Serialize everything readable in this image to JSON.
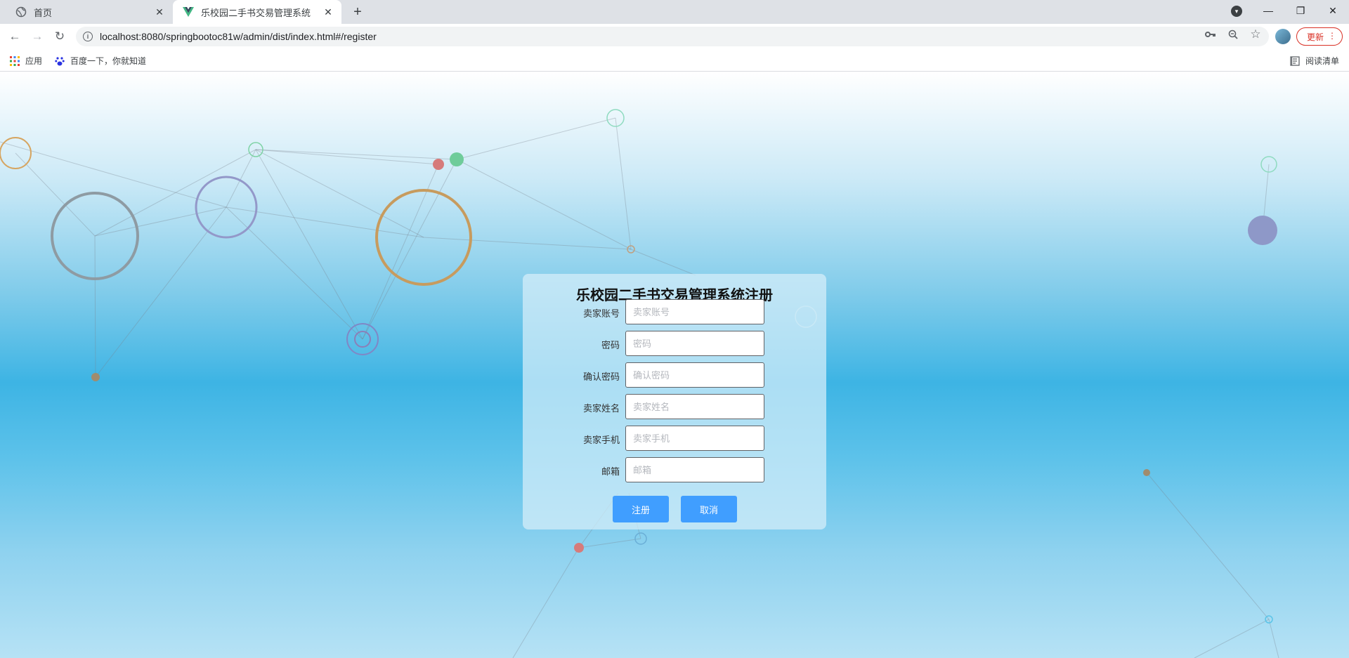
{
  "browser": {
    "tabs": [
      {
        "title": "首页",
        "icon": "globe-icon",
        "active": false
      },
      {
        "title": "乐校园二手书交易管理系统",
        "icon": "vue-logo-icon",
        "active": true
      }
    ],
    "url": "localhost:8080/springbootoc81w/admin/dist/index.html#/register",
    "update_label": "更新",
    "bookmarks": [
      {
        "label": "应用",
        "icon": "apps-grid-icon"
      },
      {
        "label": "百度一下，你就知道",
        "icon": "baidu-paw-icon"
      }
    ],
    "reading_list_label": "阅读清单"
  },
  "form": {
    "title": "乐校园二手书交易管理系统注册",
    "fields": [
      {
        "label": "卖家账号",
        "placeholder": "卖家账号",
        "value": ""
      },
      {
        "label": "密码",
        "placeholder": "密码",
        "value": ""
      },
      {
        "label": "确认密码",
        "placeholder": "确认密码",
        "value": ""
      },
      {
        "label": "卖家姓名",
        "placeholder": "卖家姓名",
        "value": ""
      },
      {
        "label": "卖家手机",
        "placeholder": "卖家手机",
        "value": ""
      },
      {
        "label": "邮箱",
        "placeholder": "邮箱",
        "value": ""
      }
    ],
    "register_label": "注册",
    "cancel_label": "取消"
  },
  "colors": {
    "primary_button": "#409eff",
    "update_red": "#d93025"
  }
}
